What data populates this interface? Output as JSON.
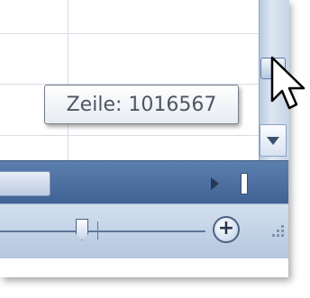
{
  "tooltip": {
    "text": "Zeile: 1016567"
  },
  "scrollbar": {
    "vertical_thumb": "scroll-thumb",
    "down_arrow_icon": "triangle-down-icon",
    "right_arrow_icon": "triangle-right-icon"
  },
  "statusbar": {
    "zoom_in_icon": "plus-icon",
    "zoom_in_label": "+",
    "resize_grip_icon": "resize-grip-icon"
  },
  "cursor": {
    "icon": "arrow-cursor-icon"
  },
  "colors": {
    "accent": "#3f6294",
    "status_bar": "#c3d3e7",
    "tooltip_text": "#4d5664"
  }
}
